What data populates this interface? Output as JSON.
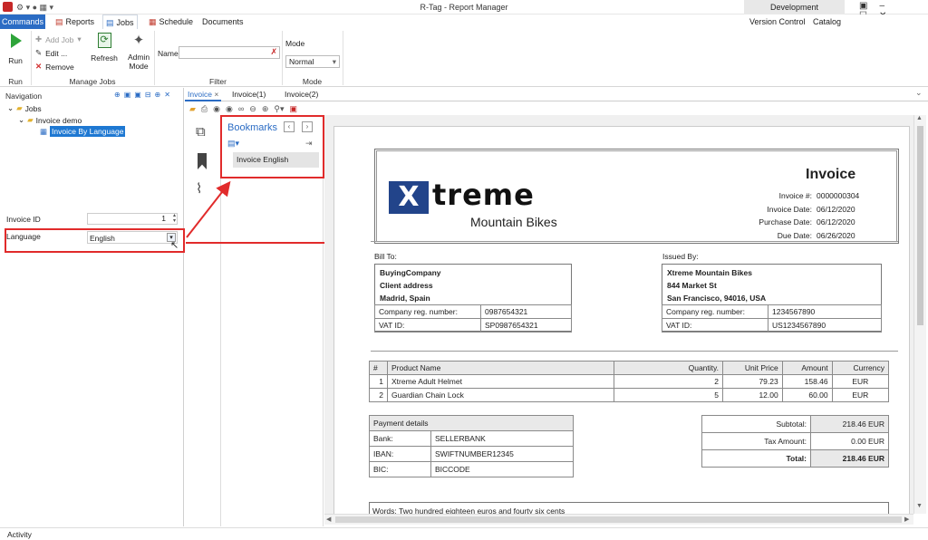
{
  "app": {
    "title": "R-Tag - Report Manager",
    "env_badge": "Development"
  },
  "ribbon_tabs": [
    "Commands",
    "Reports",
    "Jobs",
    "Schedule",
    "Documents"
  ],
  "ribbon_right": [
    "Version Control",
    "Catalog"
  ],
  "ribbon": {
    "run": "Run",
    "add_job": "Add Job",
    "edit": "Edit ...",
    "remove": "Remove",
    "refresh": "Refresh",
    "admin_mode_1": "Admin",
    "admin_mode_2": "Mode",
    "name_label": "Name",
    "mode_label": "Mode",
    "mode_value": "Normal",
    "groups": {
      "run": "Run",
      "manage_jobs": "Manage Jobs",
      "filter": "Filter",
      "mode": "Mode"
    }
  },
  "navigation": {
    "title": "Navigation",
    "tree_root": "Jobs",
    "tree_folder": "Invoice demo",
    "tree_item": "Invoice By Language"
  },
  "params": {
    "invoice_id_label": "Invoice ID",
    "invoice_id_value": "1",
    "language_label": "Language",
    "language_value": "English"
  },
  "doc_tabs": [
    "Invoice",
    "Invoice(1)",
    "Invoice(2)"
  ],
  "bookmarks": {
    "title": "Bookmarks",
    "item": "Invoice English"
  },
  "invoice": {
    "logo_word": "treme",
    "logo_sub": "Mountain Bikes",
    "title": "Invoice",
    "fields": [
      {
        "label": "Invoice #:",
        "value": "0000000304"
      },
      {
        "label": "Invoice Date:",
        "value": "06/12/2020"
      },
      {
        "label": "Purchase Date:",
        "value": "06/12/2020"
      },
      {
        "label": "Due Date:",
        "value": "06/26/2020"
      }
    ],
    "bill_to": {
      "heading": "Bill To:",
      "name": "BuyingCompany",
      "address": "Client address",
      "city": "Madrid, Spain",
      "reg_label": "Company reg. number:",
      "reg": "0987654321",
      "vat_label": "VAT ID:",
      "vat": "SP0987654321"
    },
    "issued_by": {
      "heading": "Issued By:",
      "name": "Xtreme Mountain Bikes",
      "address": "844 Market St",
      "city": "San Francisco,  94016, USA",
      "reg_label": "Company reg. number:",
      "reg": "1234567890",
      "vat_label": "VAT ID:",
      "vat": "US1234567890"
    },
    "items_headers": [
      "#",
      "Product Name",
      "Quantity.",
      "Unit Price",
      "Amount",
      "Currency"
    ],
    "items": [
      [
        "1",
        "Xtreme Adult Helmet",
        "2",
        "79.23",
        "158.46",
        "EUR"
      ],
      [
        "2",
        "Guardian Chain Lock",
        "5",
        "12.00",
        "60.00",
        "EUR"
      ]
    ],
    "payment": {
      "heading": "Payment details",
      "bank_label": "Bank:",
      "bank": "SELLERBANK",
      "iban_label": "IBAN:",
      "iban": "SWIFTNUMBER12345",
      "bic_label": "BIC:",
      "bic": "BICCODE"
    },
    "totals": {
      "subtotal_label": "Subtotal:",
      "subtotal": "218.46",
      "tax_label": "Tax Amount:",
      "tax": "0.00",
      "total_label": "Total:",
      "total": "218.46",
      "currency": "EUR"
    },
    "words": "Words: Two hundred eighteen euros and fourty six cents"
  },
  "status_bar": {
    "activity": "Activity"
  }
}
